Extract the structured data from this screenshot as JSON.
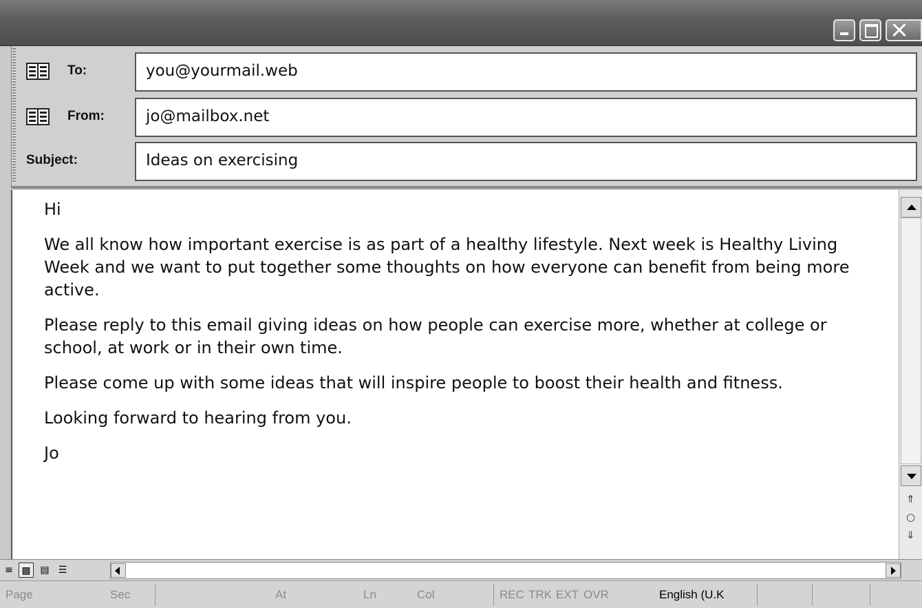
{
  "window": {
    "controls": [
      "minimize",
      "maximize",
      "close"
    ]
  },
  "header": {
    "to": {
      "label": "To:",
      "value": "you@yourmail.web",
      "icon": "address-book-icon"
    },
    "from": {
      "label": "From:",
      "value": "jo@mailbox.net",
      "icon": "address-book-icon"
    },
    "subject": {
      "label": "Subject:",
      "value": "Ideas on exercising"
    }
  },
  "body": {
    "paragraphs": [
      "Hi",
      "We all know how important exercise is as part of a healthy lifestyle. Next week is Healthy Living Week and we want to put together some thoughts on how everyone can benefit from being more active.",
      "Please reply to this email giving ideas on how people can exercise more, whether at college or school, at work or in their own time.",
      "Please come up with some ideas that will inspire people to boost their health and fitness.",
      "Looking forward to hearing from you.",
      "Jo"
    ]
  },
  "scrollbar": {
    "browse_icons": [
      "previous-page-icon",
      "select-browse-object-icon",
      "next-page-icon"
    ]
  },
  "view_buttons": [
    "normal-view-icon",
    "web-layout-view-icon",
    "print-layout-view-icon",
    "outline-view-icon"
  ],
  "status_bar": {
    "page": "Page",
    "sec": "Sec",
    "at": "At",
    "ln": "Ln",
    "col": "Col",
    "rec": "REC",
    "trk": "TRK",
    "ext": "EXT",
    "ovr": "OVR",
    "language": "English (U.K"
  }
}
